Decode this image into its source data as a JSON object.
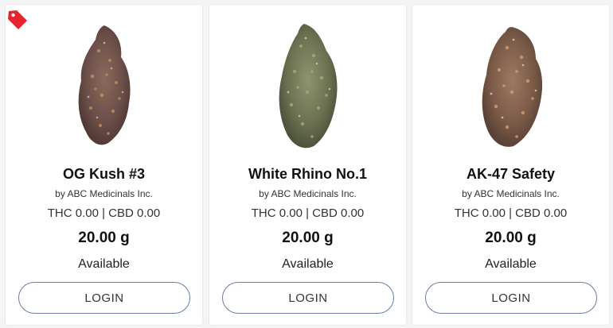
{
  "products": [
    {
      "name": "OG Kush #3",
      "brand": "by ABC Medicinals Inc.",
      "potency": "THC 0.00 | CBD 0.00",
      "weight": "20.00 g",
      "status": "Available",
      "button_label": "LOGIN",
      "image_icon": "cannabis-bud-purple"
    },
    {
      "name": "White Rhino No.1",
      "brand": "by ABC Medicinals Inc.",
      "potency": "THC 0.00 | CBD 0.00",
      "weight": "20.00 g",
      "status": "Available",
      "button_label": "LOGIN",
      "image_icon": "cannabis-bud-green"
    },
    {
      "name": "AK-47 Safety",
      "brand": "by ABC Medicinals Inc.",
      "potency": "THC 0.00 | CBD 0.00",
      "weight": "20.00 g",
      "status": "Available",
      "button_label": "LOGIN",
      "image_icon": "cannabis-bud-brown"
    }
  ],
  "sale_tag": {
    "icon": "price-tag-icon",
    "color": "#e8232b"
  },
  "colors": {
    "button_border": "#6b7fa6",
    "card_background": "#ffffff",
    "page_background": "#f3f4f6"
  }
}
